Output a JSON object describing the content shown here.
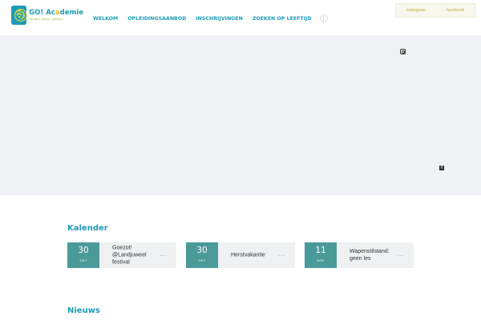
{
  "logo": {
    "title_part1": "GO! Ac",
    "title_o": "a",
    "title_part2": "demie",
    "subtitle": "Muziek & Woord ·Ledegem"
  },
  "nav": {
    "items": [
      "WELKOM",
      "OPLEIDINGSAANBOD",
      "INSCHRIJVINGEN",
      "ZOEKEN OP LEEFTIJD"
    ],
    "more_icon": "⋮"
  },
  "social_top": {
    "instagram": "Instagram",
    "facebook": "facebook"
  },
  "hero": {
    "facebook_glyph": "f"
  },
  "calendar": {
    "title": "Kalender",
    "events": [
      {
        "day": "30",
        "month": "OKT",
        "text": "Goezot! @Landjuweel festival",
        "more": "..."
      },
      {
        "day": "30",
        "month": "OKT",
        "text": "Herstvakantie",
        "more": "..."
      },
      {
        "day": "11",
        "month": "NOV",
        "text": "Wapenstilstand: geen les",
        "more": "..."
      }
    ]
  },
  "news": {
    "title": "Nieuws"
  },
  "colors": {
    "brand": "#1d9bb5",
    "date_bg": "#4a9a99",
    "accent_yellow": "#c5ac3d"
  }
}
